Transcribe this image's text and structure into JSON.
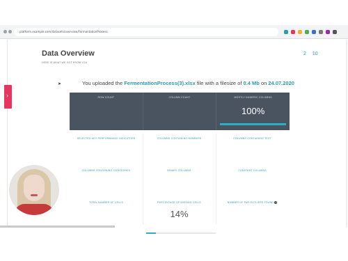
{
  "browser": {
    "url": "platform.example.com/datasets/overview/FermentationProcess"
  },
  "page": {
    "title": "Data Overview",
    "subtitle": "HERE IS WHAT WE GOT FROM YOU",
    "pager": [
      "2",
      "10"
    ]
  },
  "upload": {
    "prefix": "You uploaded the ",
    "filename": "FermentationProcess(3).xlsx",
    "middle": " file with a filesize of ",
    "filesize": "0.4 Mb",
    "on": " on ",
    "date": "24.07.2020"
  },
  "summary": {
    "row_count_label": "ROW COUNT",
    "column_count_label": "COLUMN COUNT",
    "numeric_label": "MOSTLY NUMERIC COLUMNS",
    "numeric_value": "100%",
    "numeric_fraction": 1.0
  },
  "metrics": {
    "kpi_label": "SELECTED KEY PERFORMANCE INDICATORS",
    "numbers_label": "COLUMNS CONTAINING NUMBERS",
    "text_label": "COLUMNS CONTAINING TEXT",
    "categories_label": "COLUMNS CONTAINING CATEGORIES",
    "binary_label": "BINARY COLUMNS",
    "constant_label": "CONSTANT COLUMNS",
    "total_cells_label": "TOTAL NUMBER OF CELLS",
    "missing_label": "PERCENTAGE OF MISSING CELLS",
    "missing_value": "14%",
    "missing_fraction": 0.14,
    "outliers_label": "NUMBER OF FAR OUTLIERS FOUND"
  },
  "colors": {
    "accent": "#2b9bb0",
    "panel": "#4a5461",
    "sidebar_tab": "#e8345e"
  }
}
